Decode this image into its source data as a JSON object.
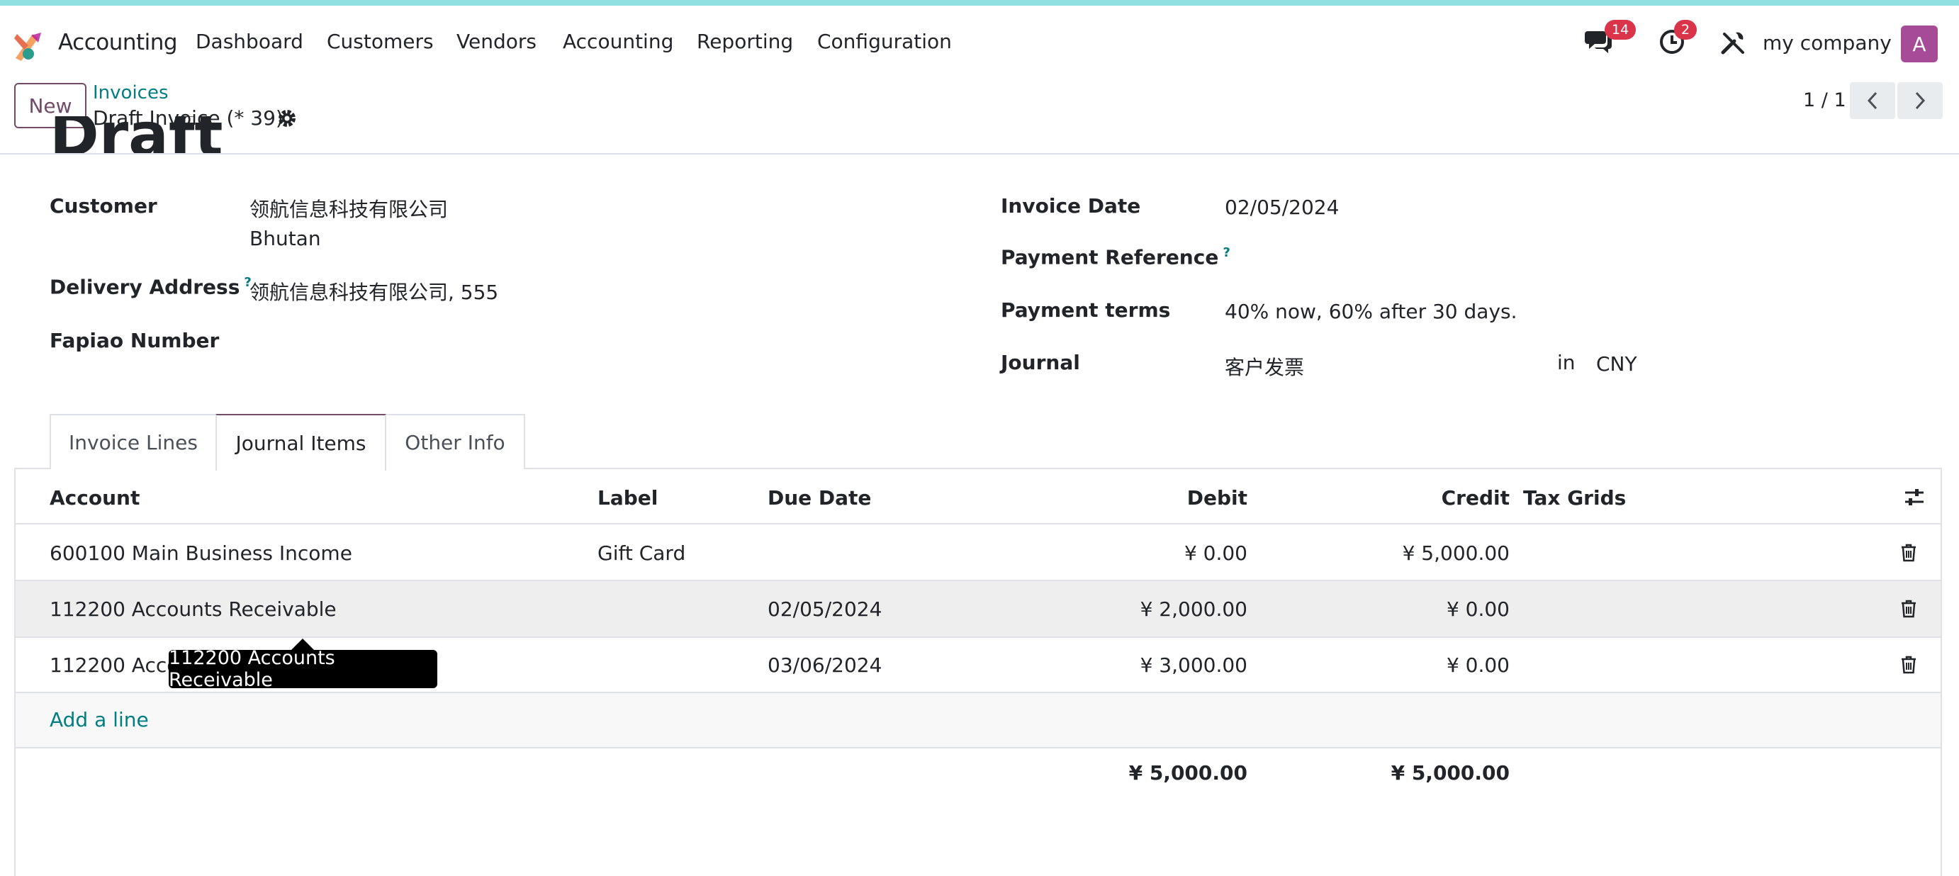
{
  "navbar": {
    "app_name": "Accounting",
    "menu": [
      "Dashboard",
      "Customers",
      "Vendors",
      "Accounting",
      "Reporting",
      "Configuration"
    ],
    "messages_badge": "14",
    "activities_badge": "2",
    "company": "my company",
    "avatar_letter": "A"
  },
  "control": {
    "new_label": "New",
    "breadcrumb_parent": "Invoices",
    "breadcrumb_current": "Draft Invoice (* 39)",
    "pager": "1 / 1"
  },
  "form": {
    "title": "Draft",
    "customer_label": "Customer",
    "customer_name": "领航信息科技有限公司",
    "customer_country": "Bhutan",
    "delivery_label": "Delivery Address",
    "delivery_value": "领航信息科技有限公司, 555",
    "fapiao_label": "Fapiao Number",
    "invoice_date_label": "Invoice Date",
    "invoice_date": "02/05/2024",
    "payment_ref_label": "Payment Reference",
    "payment_terms_label": "Payment terms",
    "payment_terms": "40% now, 60% after 30 days.",
    "journal_label": "Journal",
    "journal": "客户发票",
    "journal_in": "in",
    "currency": "CNY",
    "help_mark": "?"
  },
  "tabs": [
    "Invoice Lines",
    "Journal Items",
    "Other Info"
  ],
  "table": {
    "headers": {
      "account": "Account",
      "label": "Label",
      "due_date": "Due Date",
      "debit": "Debit",
      "credit": "Credit",
      "tax_grids": "Tax Grids"
    },
    "rows": [
      {
        "account": "600100 Main Business Income",
        "label": "Gift Card",
        "due_date": "",
        "debit": "¥ 0.00",
        "credit": "¥ 5,000.00"
      },
      {
        "account": "112200 Accounts Receivable",
        "label": "",
        "due_date": "02/05/2024",
        "debit": "¥ 2,000.00",
        "credit": "¥ 0.00"
      },
      {
        "account": "112200 Accounts Receivable",
        "label": "",
        "due_date": "03/06/2024",
        "debit": "¥ 3,000.00",
        "credit": "¥ 0.00"
      }
    ],
    "add_line": "Add a line",
    "total_debit": "¥ 5,000.00",
    "total_credit": "¥ 5,000.00"
  },
  "tooltip": "112200 Accounts Receivable",
  "colors": {
    "brand": "#714b67",
    "link": "#017e84",
    "badge": "#d9344a",
    "avatar": "#a64c96"
  }
}
